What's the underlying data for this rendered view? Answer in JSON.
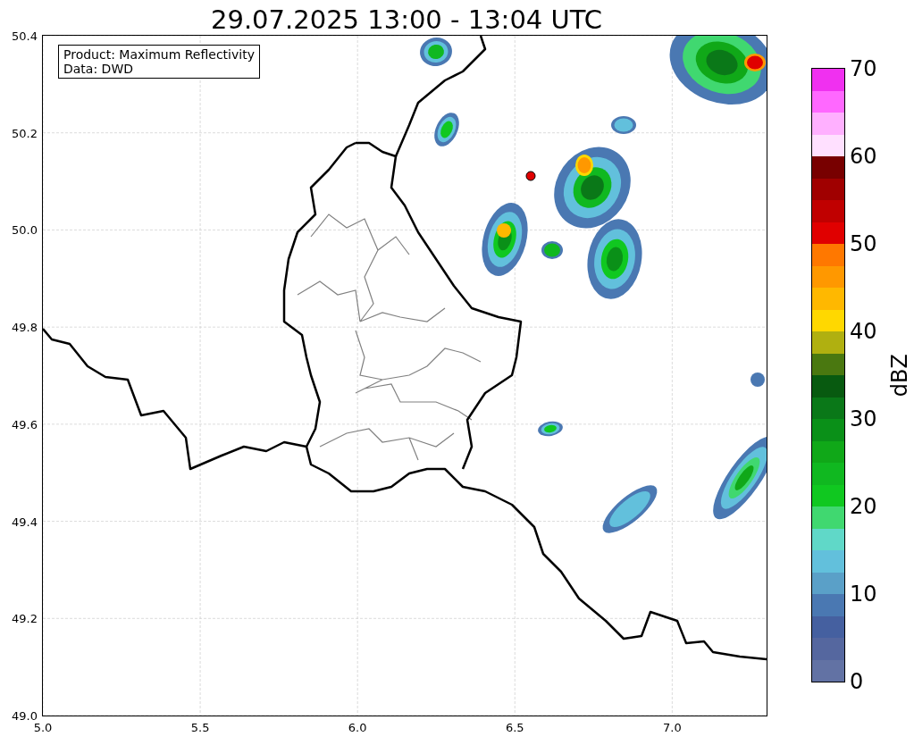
{
  "title": "29.07.2025 13:00 - 13:04 UTC",
  "info_box": [
    "Product: Maximum Reflectivity",
    "Data: DWD"
  ],
  "map": {
    "x_ticks": [
      "5.0",
      "5.5",
      "6.0",
      "6.5",
      "7.0"
    ],
    "y_ticks": [
      "50.4",
      "50.2",
      "50.0",
      "49.8",
      "49.6",
      "49.4",
      "49.2",
      "49.0"
    ]
  },
  "colorbar": {
    "label": "dBZ",
    "ticks": [
      "70",
      "60",
      "50",
      "40",
      "30",
      "20",
      "10",
      "0"
    ],
    "segments": [
      {
        "color": "#6272a4"
      },
      {
        "color": "#55679f"
      },
      {
        "color": "#4560a0"
      },
      {
        "color": "#4a78b2"
      },
      {
        "color": "#5aa0c8"
      },
      {
        "color": "#62c0dc"
      },
      {
        "color": "#60d8c8"
      },
      {
        "color": "#40d870"
      },
      {
        "color": "#10c820"
      },
      {
        "color": "#10b820"
      },
      {
        "color": "#10a818"
      },
      {
        "color": "#0a9018"
      },
      {
        "color": "#0a7818"
      },
      {
        "color": "#085a10"
      },
      {
        "color": "#4a7810"
      },
      {
        "color": "#b0b010"
      },
      {
        "color": "#ffd800"
      },
      {
        "color": "#ffb800"
      },
      {
        "color": "#ff9800"
      },
      {
        "color": "#ff7800"
      },
      {
        "color": "#e00000"
      },
      {
        "color": "#c00000"
      },
      {
        "color": "#a00000"
      },
      {
        "color": "#780000"
      },
      {
        "color": "#ffe0ff"
      },
      {
        "color": "#ffb0ff"
      },
      {
        "color": "#ff68ff"
      },
      {
        "color": "#f030f0"
      }
    ]
  }
}
